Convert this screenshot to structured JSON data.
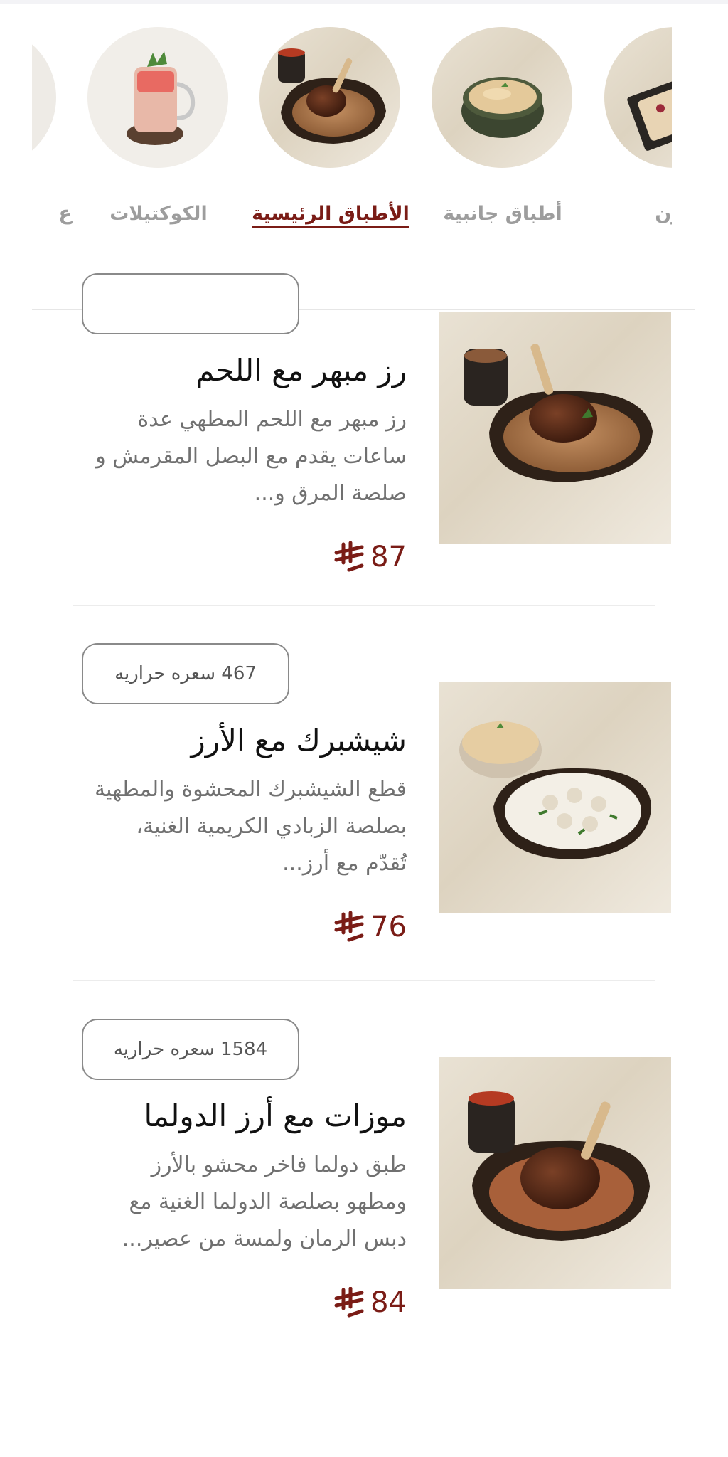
{
  "categories": [
    {
      "label": "فرن",
      "icon": "dessert-plate-icon",
      "active": false
    },
    {
      "label": "أطباق جانبية",
      "icon": "rice-bowl-icon",
      "active": false
    },
    {
      "label": "الأطباق الرئيسية",
      "icon": "lamb-rice-icon",
      "active": true
    },
    {
      "label": "الكوكتيلات",
      "icon": "cocktail-glass-icon",
      "active": false
    },
    {
      "label": "ع",
      "icon": "partial-category-icon",
      "active": false
    }
  ],
  "items": [
    {
      "title": "رز مبهر مع اللحم",
      "description": "رز مبهر مع اللحم المطهي عدة ساعات يقدم مع البصل المقرمش و صلصة المرق و...",
      "price": "87",
      "calories": "",
      "calories_label": "",
      "image": "lamb-shank-rice-photo"
    },
    {
      "title": "شيشبرك مع الأرز",
      "description": "قطع الشيشبرك المحشوة والمطهية بصلصة الزبادي الكريمية الغنية، تُقدّم مع أرز...",
      "price": "76",
      "calories": "467",
      "calories_label": "سعره حراريه",
      "image": "shishbarak-yogurt-photo"
    },
    {
      "title": "موزات مع أرز الدولما",
      "description": "طبق دولما فاخر محشو بالأرز ومطهو بصلصة الدولما الغنية مع دبس الرمان ولمسة من عصير...",
      "price": "84",
      "calories": "1584",
      "calories_label": "سعره حراريه",
      "image": "lamb-dolma-rice-photo"
    }
  ],
  "colors": {
    "accent": "#7a1c16",
    "inactive_tab": "#9d9d9d",
    "description": "#707070",
    "divider": "#ececec"
  }
}
